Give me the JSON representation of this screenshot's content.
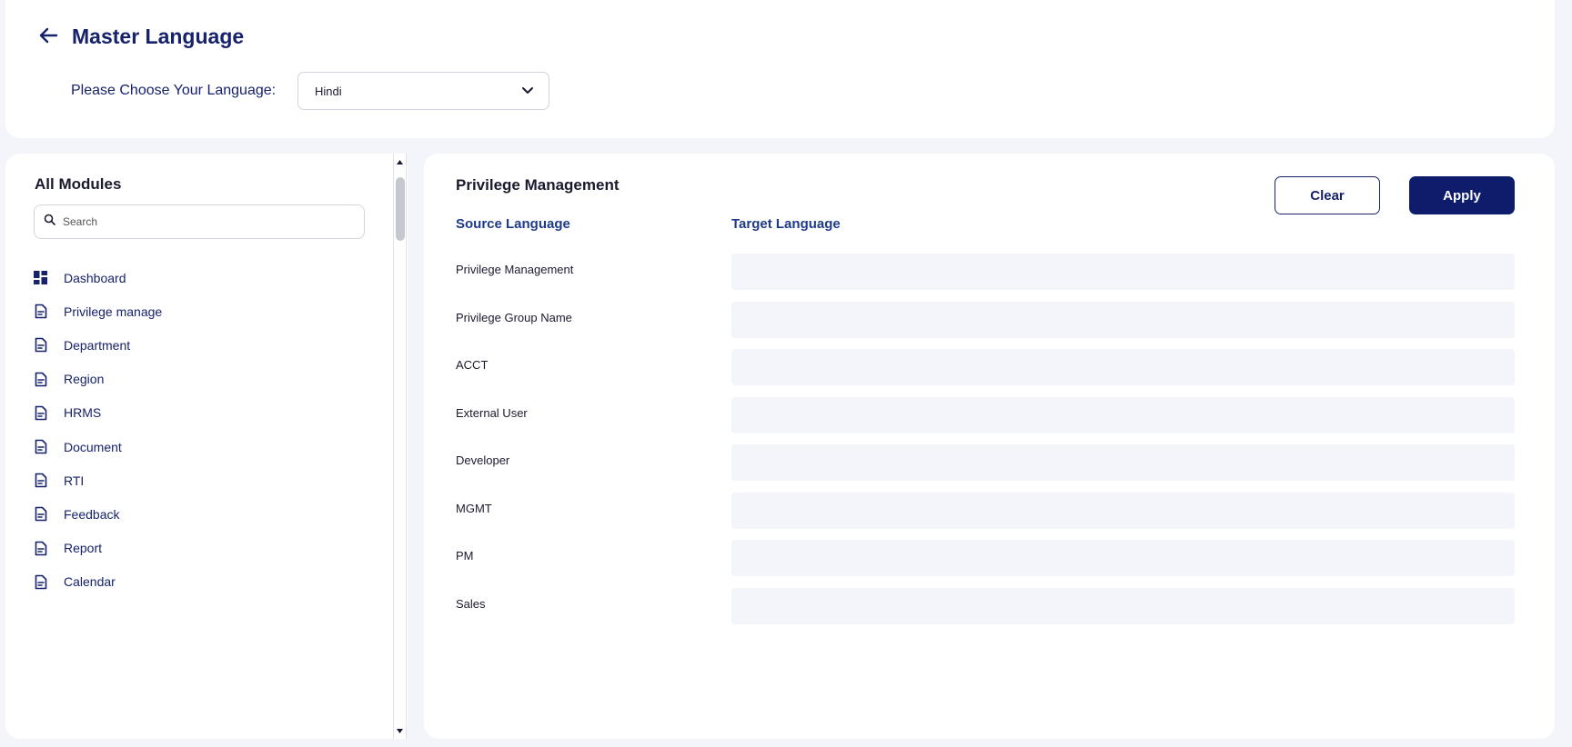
{
  "header": {
    "title": "Master Language",
    "language_label": "Please Choose Your Language:",
    "language_selected": "Hindi"
  },
  "sidebar": {
    "title": "All Modules",
    "search_placeholder": "Search",
    "items": [
      {
        "label": "Dashboard",
        "icon": "dashboard-grid-icon"
      },
      {
        "label": "Privilege manage",
        "icon": "document-icon"
      },
      {
        "label": "Department",
        "icon": "document-icon"
      },
      {
        "label": "Region",
        "icon": "document-icon"
      },
      {
        "label": "HRMS",
        "icon": "document-icon"
      },
      {
        "label": "Document",
        "icon": "document-icon"
      },
      {
        "label": "RTI",
        "icon": "document-icon"
      },
      {
        "label": "Feedback",
        "icon": "document-icon"
      },
      {
        "label": "Report",
        "icon": "document-icon"
      },
      {
        "label": "Calendar",
        "icon": "document-icon"
      }
    ]
  },
  "main": {
    "section_title": "Privilege Management",
    "source_header": "Source Language",
    "target_header": "Target Language",
    "clear_label": "Clear",
    "apply_label": "Apply",
    "rows": [
      {
        "source": "Privilege Management",
        "target": ""
      },
      {
        "source": "Privilege Group Name",
        "target": ""
      },
      {
        "source": "ACCT",
        "target": ""
      },
      {
        "source": "External User",
        "target": ""
      },
      {
        "source": "Developer",
        "target": ""
      },
      {
        "source": "MGMT",
        "target": ""
      },
      {
        "source": "PM",
        "target": ""
      },
      {
        "source": "Sales",
        "target": ""
      }
    ]
  },
  "colors": {
    "primary": "#0d1c6b",
    "heading": "#16226b",
    "background": "#f4f5fa",
    "input_fill": "#f4f5fa"
  }
}
